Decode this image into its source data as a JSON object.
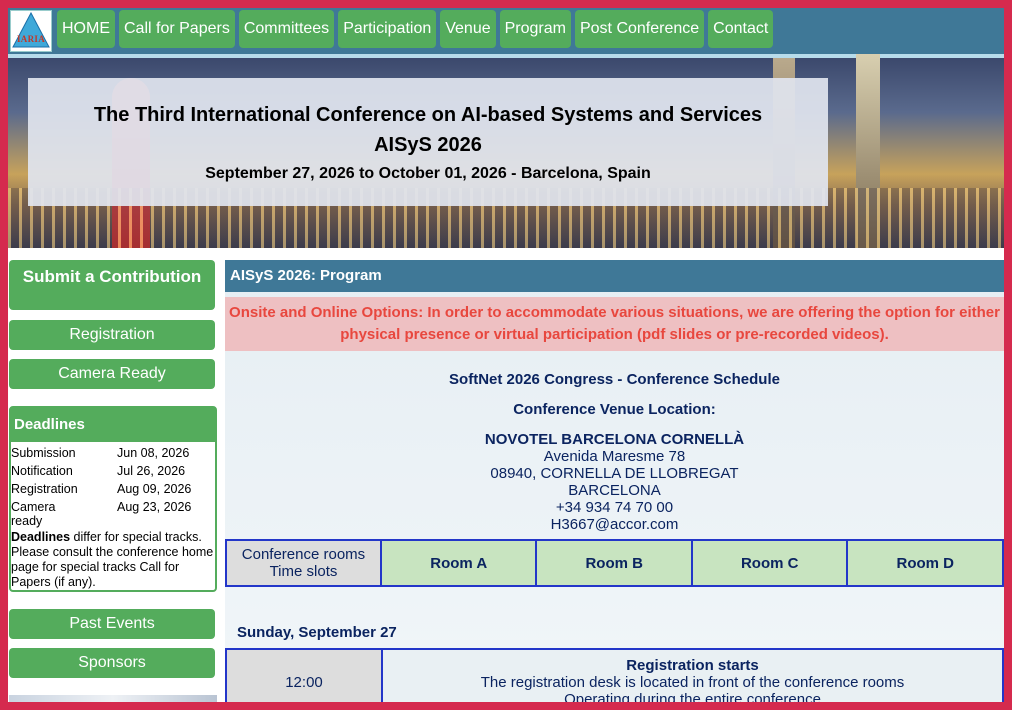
{
  "nav": {
    "logo_text": "IARIA",
    "items": [
      "HOME",
      "Call for Papers",
      "Committees",
      "Participation",
      "Venue",
      "Program",
      "Post Conference",
      "Contact"
    ]
  },
  "banner": {
    "title": "The Third International Conference on AI-based Systems and Services",
    "acronym": "AISyS 2026",
    "dates": "September 27, 2026 to October 01, 2026 - Barcelona, Spain"
  },
  "sidebar": {
    "submit": "Submit a Contribution",
    "registration": "Registration",
    "camera_ready": "Camera Ready",
    "deadlines_title": "Deadlines",
    "deadlines": [
      {
        "label": "Submission",
        "date": "Jun 08, 2026"
      },
      {
        "label": "Notification",
        "date": "Jul 26, 2026"
      },
      {
        "label": "Registration",
        "date": "Aug 09, 2026"
      },
      {
        "label": "Camera ready",
        "date": "Aug 23, 2026"
      }
    ],
    "note_bold": "Deadlines",
    "note_rest": " differ for special tracks. Please consult the conference home page for special tracks Call for Papers (if any).",
    "past_events": "Past Events",
    "sponsors": "Sponsors"
  },
  "main": {
    "header": "AISyS 2026: Program",
    "notice": "Onsite and Online Options: In order to accommodate various situations, we are offering the option for either physical presence or virtual participation (pdf slides or pre-recorded videos).",
    "schedule_title": "SoftNet 2026 Congress - Conference Schedule",
    "venue_label": "Conference Venue Location:",
    "hotel": "NOVOTEL BARCELONA CORNELLÀ",
    "address": [
      "Avenida Maresme 78",
      "08940, CORNELLA DE LLOBREGAT",
      "BARCELONA",
      "+34 934 74 70 00",
      "H3667@accor.com"
    ],
    "rooms_header": [
      "Conference rooms",
      "Time slots"
    ],
    "rooms": [
      "Room A",
      "Room B",
      "Room C",
      "Room D"
    ],
    "day": "Sunday, September 27",
    "first_slot": {
      "time": "12:00",
      "title": "Registration starts",
      "line1": "The registration desk is located in front of the conference rooms",
      "line2": "Operating during the entire conference"
    }
  }
}
